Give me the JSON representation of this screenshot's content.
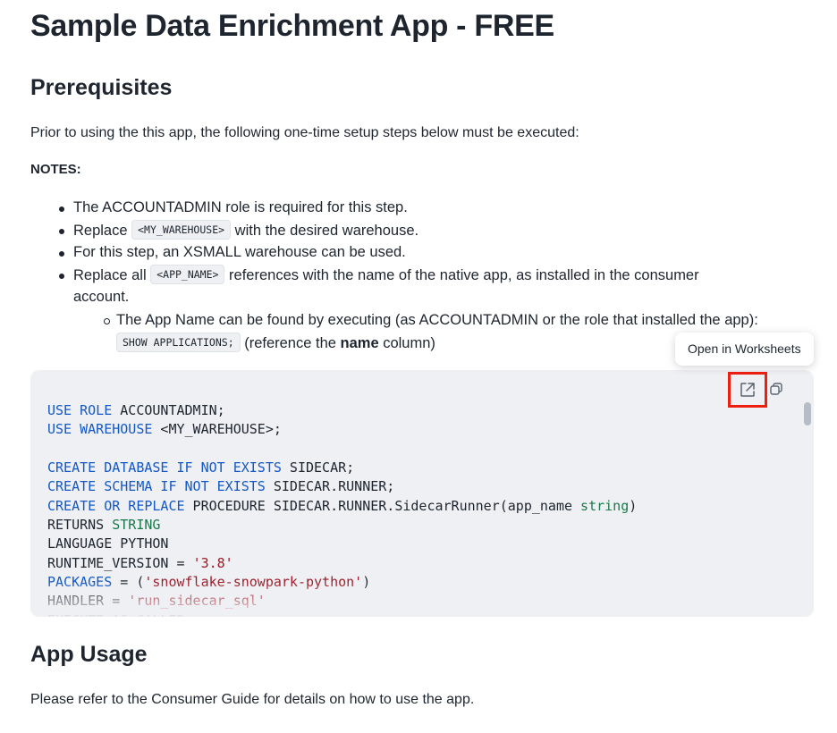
{
  "title": "Sample Data Enrichment App - FREE",
  "prerequisites": {
    "heading": "Prerequisites",
    "intro": "Prior to using the this app, the following one-time setup steps below must be executed:",
    "notes_label": "NOTES:",
    "bullets": [
      {
        "text": "The ACCOUNTADMIN role is required for this step."
      },
      {
        "pre": "Replace ",
        "code": "<MY_WAREHOUSE>",
        "post": " with the desired warehouse."
      },
      {
        "text": "For this step, an XSMALL warehouse can be used."
      },
      {
        "pre": "Replace all ",
        "code": "<APP_NAME>",
        "post": " references with the name of the native app, as installed in the consumer",
        "line2": "account."
      }
    ],
    "sub_bullet": {
      "line1": "The App Name can be found by executing (as ACCOUNTADMIN or the role that installed the app):",
      "code": "SHOW APPLICATIONS;",
      "post_pre": " (reference the ",
      "post_bold": "name",
      "post_end": " column)"
    }
  },
  "code_block": {
    "tooltip": "Open in Worksheets",
    "open_icon": "external-link-icon",
    "copy_icon": "copy-icon",
    "colors": {
      "keyword": "#1458c7",
      "string": "#9a1a28",
      "type": "#197a4b",
      "highlight_border": "#ef1f10"
    },
    "lines": [
      [
        {
          "t": "USE ROLE",
          "c": "kw"
        },
        {
          "t": " ACCOUNTADMIN;"
        }
      ],
      [
        {
          "t": "USE WAREHOUSE",
          "c": "kw"
        },
        {
          "t": " <MY_WAREHOUSE>;"
        }
      ],
      [],
      [
        {
          "t": "CREATE DATABASE IF NOT EXISTS",
          "c": "kw"
        },
        {
          "t": " SIDECAR;"
        }
      ],
      [
        {
          "t": "CREATE SCHEMA IF NOT EXISTS",
          "c": "kw"
        },
        {
          "t": " SIDECAR.RUNNER;"
        }
      ],
      [
        {
          "t": "CREATE OR REPLACE",
          "c": "kw"
        },
        {
          "t": " PROCEDURE SIDECAR.RUNNER.SidecarRunner(app_name "
        },
        {
          "t": "string",
          "c": "typ"
        },
        {
          "t": ")"
        }
      ],
      [
        {
          "t": "RETURNS "
        },
        {
          "t": "STRING",
          "c": "typ"
        }
      ],
      [
        {
          "t": "LANGUAGE PYTHON"
        }
      ],
      [
        {
          "t": "RUNTIME_VERSION = "
        },
        {
          "t": "'3.8'",
          "c": "str"
        }
      ],
      [
        {
          "t": "PACKAGES",
          "c": "kw"
        },
        {
          "t": " = ("
        },
        {
          "t": "'snowflake-snowpark-python'",
          "c": "str"
        },
        {
          "t": ")"
        }
      ],
      [
        {
          "t": "HANDLER = "
        },
        {
          "t": "'run_sidecar_sql'",
          "c": "str"
        }
      ],
      [
        {
          "t": "EXECUTE AS CALLER"
        }
      ]
    ]
  },
  "usage": {
    "heading": "App Usage",
    "text": "Please refer to the Consumer Guide for details on how to use the app."
  }
}
